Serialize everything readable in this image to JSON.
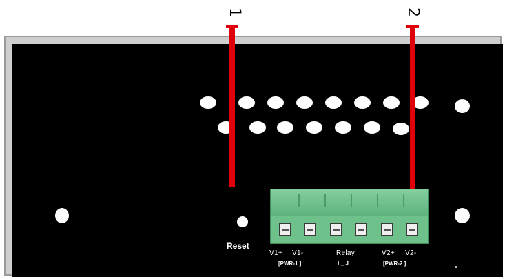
{
  "callouts": [
    {
      "number": "1"
    },
    {
      "number": "2"
    }
  ],
  "labels": {
    "reset": "Reset",
    "v1_plus": "V1+",
    "v1_minus": "V1-",
    "relay": "Relay",
    "v2_plus": "V2+",
    "v2_minus": "V2-",
    "pwr1": "[PWR-1 ]",
    "pwr2": "[PWR-2 ]",
    "relay_bracket": "L_ J"
  },
  "colors": {
    "panel": "#000000",
    "callout": "#e0000a",
    "terminal_block": "#6fc18c"
  }
}
